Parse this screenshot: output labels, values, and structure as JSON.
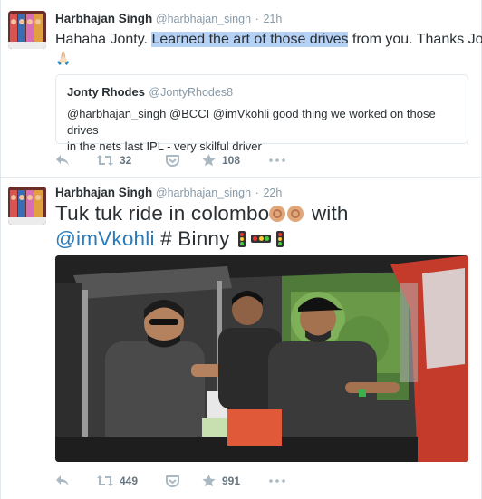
{
  "tweets": [
    {
      "author": {
        "fullname": "Harbhajan Singh",
        "username": "@harbhajan_singh",
        "time": "21h"
      },
      "text": {
        "before": "Hahaha Jonty. ",
        "highlighted": "Learned the art of those drives",
        "after": " from you. Thanks Jonty",
        "line2": "🙏🏻"
      },
      "quote": {
        "fullname": "Jonty Rhodes",
        "username": "@JontyRhodes8",
        "text_line1": "@harbhajan_singh @BCCI @imVkohli good thing we worked on those drives",
        "text_line2": "in the nets last IPL - very skilful driver"
      },
      "actions": {
        "retweets": "32",
        "likes": "108"
      }
    },
    {
      "author": {
        "fullname": "Harbhajan Singh",
        "username": "@harbhajan_singh",
        "time": "22h"
      },
      "text": {
        "line1_before": "Tuk tuk ride in colombo",
        "line1_after": " with",
        "mention": "@imVkohli",
        "line2_after": " # Binny "
      },
      "actions": {
        "retweets": "449",
        "likes": "991"
      }
    }
  ],
  "separators": {
    "dot": "·"
  },
  "icons": {
    "reply": "reply-icon",
    "retweet": "retweet-icon",
    "save": "pocket-icon",
    "like": "star-icon",
    "more": "more-icon"
  },
  "colors": {
    "highlight": "#b5d1f5",
    "mention": "#2b7bb9",
    "muted": "#8899a6",
    "text": "#292f33"
  }
}
